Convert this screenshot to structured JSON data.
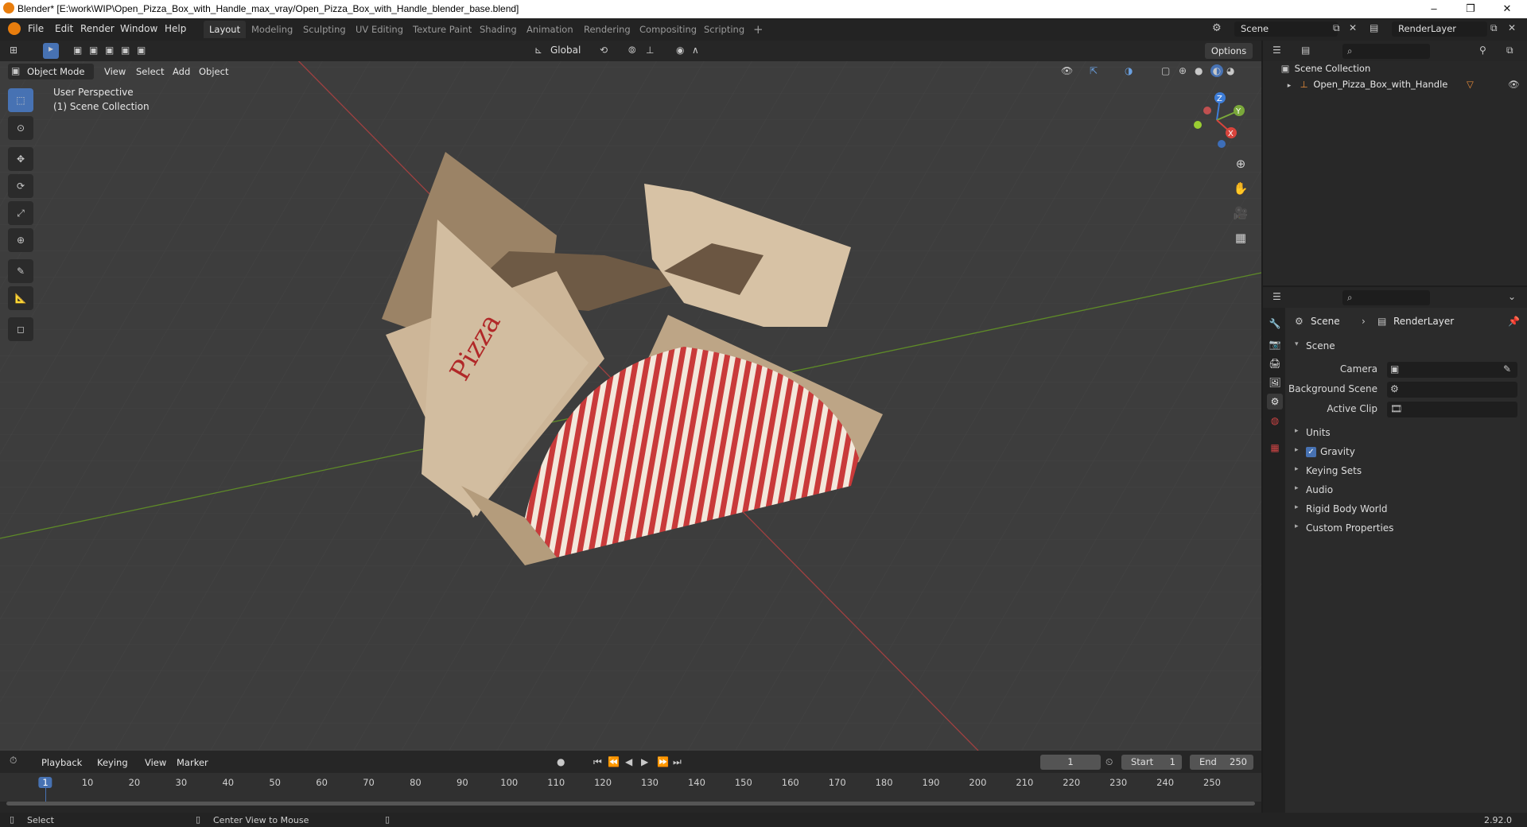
{
  "window": {
    "title": "Blender* [E:\\work\\WIP\\Open_Pizza_Box_with_Handle_max_vray/Open_Pizza_Box_with_Handle_blender_base.blend]",
    "minimize": "–",
    "maximize": "❐",
    "close": "✕"
  },
  "menu": [
    "File",
    "Edit",
    "Render",
    "Window",
    "Help"
  ],
  "workspaces": [
    "Layout",
    "Modeling",
    "Sculpting",
    "UV Editing",
    "Texture Paint",
    "Shading",
    "Animation",
    "Rendering",
    "Compositing",
    "Scripting"
  ],
  "active_workspace": "Layout",
  "add_workspace": "+",
  "scene_field": "Scene",
  "view_layer_field": "RenderLayer",
  "viewport": {
    "mode": "Object Mode",
    "header_menus": [
      "View",
      "Select",
      "Add",
      "Object"
    ],
    "transform_orientation": "Global",
    "options": "Options",
    "overlay_title": "User Perspective",
    "overlay_collection": "(1) Scene Collection",
    "gizmo_axes": {
      "x": "X",
      "y": "Y",
      "z": "Z"
    },
    "colors": {
      "background": "#3d3d3d",
      "x_axis": "#c03c3c",
      "y_axis": "#6a9a2a",
      "active_tool": "#4772b3"
    }
  },
  "tools": [
    "select-box-icon",
    "cursor-icon",
    "move-icon",
    "rotate-icon",
    "scale-icon",
    "transform-icon",
    "annotate-icon",
    "measure-icon",
    "add-cube-icon"
  ],
  "nav_gizmos": [
    "zoom-icon",
    "pan-hand-icon",
    "camera-icon",
    "grid-icon"
  ],
  "outliner": {
    "root": "Scene Collection",
    "items": [
      {
        "name": "Open_Pizza_Box_with_Handle"
      }
    ]
  },
  "properties": {
    "breadcrumb_scene": "Scene",
    "breadcrumb_layer": "RenderLayer",
    "panel_title": "Scene",
    "fields": [
      {
        "label": "Camera",
        "value": ""
      },
      {
        "label": "Background Scene",
        "value": ""
      },
      {
        "label": "Active Clip",
        "value": ""
      }
    ],
    "sections": [
      "Units",
      "Gravity",
      "Keying Sets",
      "Audio",
      "Rigid Body World",
      "Custom Properties"
    ],
    "gravity_checked": true
  },
  "timeline": {
    "menus": [
      "Playback",
      "Keying",
      "View",
      "Marker"
    ],
    "current_frame": "1",
    "start_label": "Start",
    "start": "1",
    "end_label": "End",
    "end": "250",
    "ticks": [
      "1",
      "10",
      "20",
      "30",
      "40",
      "50",
      "60",
      "70",
      "80",
      "90",
      "100",
      "110",
      "120",
      "130",
      "140",
      "150",
      "160",
      "170",
      "180",
      "190",
      "200",
      "210",
      "220",
      "230",
      "240",
      "250"
    ]
  },
  "status": {
    "select": "Select",
    "center_view": "Center View to Mouse",
    "version": "2.92.0"
  }
}
